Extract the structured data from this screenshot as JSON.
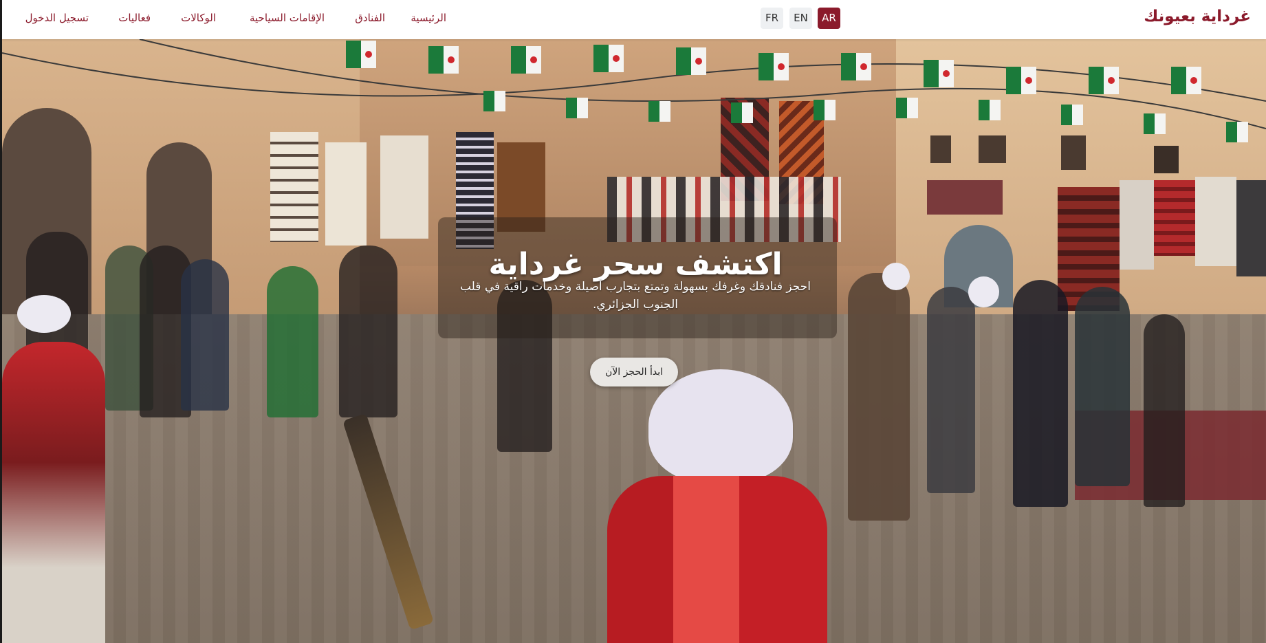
{
  "header": {
    "brand": "غرداية بعيونك",
    "languages": [
      {
        "label": "AR",
        "active": true
      },
      {
        "label": "EN",
        "active": false
      },
      {
        "label": "FR",
        "active": false
      }
    ],
    "nav": {
      "home": "الرئيسية",
      "hotels": "الفنادق",
      "stays": "الإقامات السياحية",
      "agencies": "الوكالات",
      "events": "فعاليات",
      "login": "تسجيل الدخول"
    }
  },
  "hero": {
    "title": "اكتشف سحر غرداية",
    "subtitle": "احجز فنادقك وغرفك بسهولة وتمتع بتجارب أصيلة وخدمات راقية في قلب الجنوب الجزائري.",
    "cta": "ابدأ الحجز الآن"
  },
  "colors": {
    "brand": "#8b1a2b",
    "nav_link": "#8b1a2b",
    "lang_active_bg": "#8b1a2b",
    "lang_inactive_bg": "#eef0f2",
    "cta_bg": "#e9e7e4"
  },
  "icons": {
    "hero_background": "market-square-photo"
  }
}
